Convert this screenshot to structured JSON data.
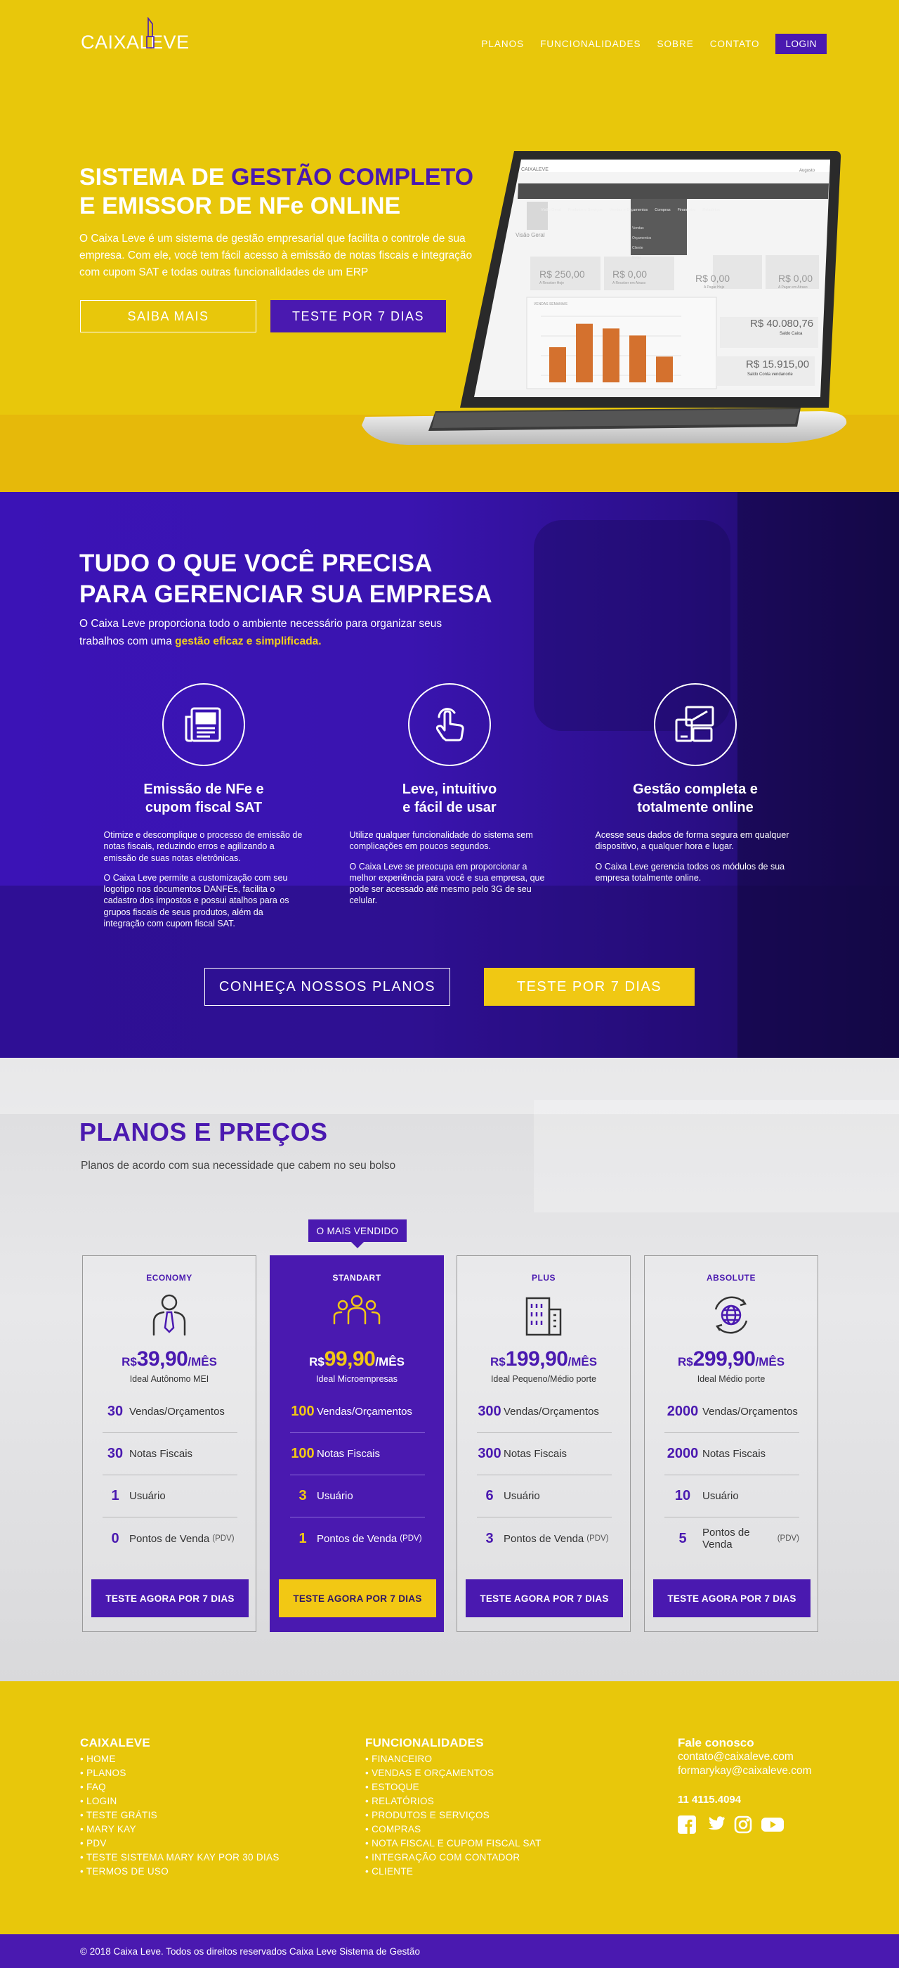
{
  "brand": {
    "logo_text": "CAIXA",
    "logo_text_2": "LEVE",
    "purple": "#4a19b0",
    "yellow": "#e8c70b"
  },
  "nav": {
    "items": [
      "PLANOS",
      "FUNCIONALIDADES",
      "SOBRE",
      "CONTATO"
    ],
    "login": "LOGIN"
  },
  "hero": {
    "title_1a": "SISTEMA DE ",
    "title_1b": "GESTÃO COMPLETO",
    "title_2a": "E EMISSOR DE ",
    "title_2b": "NFe ONLINE",
    "description": "O Caixa Leve é um sistema de gestão empresarial que facilita o controle de sua empresa. Com ele, você tem fácil acesso à emissão de notas fiscais e integração com cupom SAT e todas outras funcionalidades de um ERP",
    "btn_more": "SAIBA MAIS",
    "btn_trial": "TESTE POR 7 DIAS"
  },
  "laptop": {
    "app_logo": "CAIXALEVE",
    "user": "Augusto",
    "menu": [
      "Visão Geral",
      "Produtos e Serviços",
      "Vendas e Orçamentos",
      "Compras",
      "Financeiro",
      "Relatórios"
    ],
    "dropdown": [
      "Vendas",
      "Orçamentos",
      "Cliente",
      "Notas"
    ],
    "page_title": "Visão Geral",
    "kpis": [
      {
        "value": "R$ 250,00",
        "label": "A Receber Hoje"
      },
      {
        "value": "R$ 0,00",
        "label": "A Receber em Atraso"
      },
      {
        "value": "R$ 0,00",
        "label": "A Pagar Hoje"
      },
      {
        "value": "R$ 0,00",
        "label": "A Pagar em Atraso"
      }
    ],
    "chart_title": "VENDAS SEMANAIS",
    "chart_data": {
      "type": "bar",
      "categories": [
        "",
        "",
        "",
        "",
        ""
      ],
      "values": [
        30,
        50,
        46,
        40,
        22
      ],
      "ylim": [
        0,
        60
      ]
    },
    "balances": [
      {
        "value": "R$ 40.080,76",
        "label": "Saldo Caixa"
      },
      {
        "value": "R$ 15.915,00",
        "label": "Saldo Conta vendanorte"
      }
    ]
  },
  "features": {
    "title_1": "TUDO O QUE VOCÊ PRECISA",
    "title_2": "PARA GERENCIAR SUA EMPRESA",
    "desc": "O Caixa Leve proporciona todo o ambiente necessário para organizar seus trabalhos com uma ",
    "desc_hl": "gestão eficaz e simplificada.",
    "items": [
      {
        "icon": "newspaper-icon",
        "name_1": "Emissão de NFe e",
        "name_2": "cupom fiscal SAT",
        "p1": "Otimize e descomplique o processo de emissão de notas fiscais, reduzindo erros e agilizando a emissão de suas notas eletrônicas.",
        "p2": "O Caixa Leve permite a customização com seu logotipo nos documentos DANFEs, facilita o cadastro dos impostos e possui atalhos para os grupos fiscais de seus produtos, além da integração com cupom fiscal SAT."
      },
      {
        "icon": "touch-hand-icon",
        "name_1": "Leve, intuitivo",
        "name_2": "e fácil de usar",
        "p1": "Utilize qualquer funcionalidade do sistema sem complicações em poucos segundos.",
        "p2": "O Caixa Leve se preocupa em proporcionar a melhor experiência para você e sua empresa, que pode ser acessado até mesmo pelo 3G de seu celular."
      },
      {
        "icon": "devices-icon",
        "name_1": "Gestão completa e",
        "name_2": "totalmente online",
        "p1": "Acesse seus dados de forma segura em qualquer dispositivo, a qualquer hora e lugar.",
        "p2": "O Caixa Leve gerencia todos os módulos de sua empresa totalmente online."
      }
    ],
    "btn_plans": "CONHEÇA NOSSOS PLANOS",
    "btn_trial": "TESTE POR 7 DIAS"
  },
  "plans": {
    "title": "PLANOS E PREÇOS",
    "subtitle": "Planos de acordo com sua necessidade que cabem no seu bolso",
    "badge": "O MAIS VENDIDO",
    "currency": "R$",
    "per": "/MÊS",
    "labels": {
      "sales": "Vendas/Orçamentos",
      "invoices": "Notas Fiscais",
      "users": "Usuário",
      "pos": "Pontos de Venda",
      "pos_small": "(PDV)"
    },
    "cards": [
      {
        "name": "ECONOMY",
        "icon": "person-tie-icon",
        "price": "39,90",
        "ideal": "Ideal Autônomo MEI",
        "sales": "30",
        "invoices": "30",
        "users": "1",
        "pos": "0",
        "btn": "TESTE AGORA POR 7 DIAS"
      },
      {
        "name": "STANDART",
        "icon": "team-icon",
        "price": "99,90",
        "ideal": "Ideal Microempresas",
        "sales": "100",
        "invoices": "100",
        "users": "3",
        "pos": "1",
        "btn": "TESTE AGORA POR 7 DIAS"
      },
      {
        "name": "PLUS",
        "icon": "building-icon",
        "price": "199,90",
        "ideal": "Ideal Pequeno/Médio porte",
        "sales": "300",
        "invoices": "300",
        "users": "6",
        "pos": "3",
        "btn": "TESTE AGORA POR 7 DIAS"
      },
      {
        "name": "ABSOLUTE",
        "icon": "globe-icon",
        "price": "299,90",
        "ideal": "Ideal Médio porte",
        "sales": "2000",
        "invoices": "2000",
        "users": "10",
        "pos": "5",
        "btn": "TESTE AGORA POR 7 DIAS"
      }
    ]
  },
  "footer": {
    "col1_title": "CAIXALEVE",
    "col1": [
      "• HOME",
      "• PLANOS",
      "• FAQ",
      "• LOGIN",
      "• TESTE GRÁTIS",
      "• MARY KAY",
      "• PDV",
      "• TESTE SISTEMA MARY KAY POR 30 DIAS",
      "• TERMOS DE USO"
    ],
    "col2_title": "FUNCIONALIDADES",
    "col2": [
      "• FINANCEIRO",
      "• VENDAS E ORÇAMENTOS",
      "• ESTOQUE",
      "• RELATÓRIOS",
      "• PRODUTOS E SERVIÇOS",
      "• COMPRAS",
      "• NOTA FISCAL E CUPOM FISCAL SAT",
      "• INTEGRAÇÃO COM CONTADOR",
      "• CLIENTE"
    ],
    "contact_title": "Fale conosco",
    "email_1": "contato@caixaleve.com",
    "email_2": "formarykay@caixaleve.com",
    "phone": "11 4115.4094",
    "socials": [
      "facebook-icon",
      "twitter-icon",
      "instagram-icon",
      "youtube-icon"
    ],
    "copyright": "© 2018 Caixa Leve. Todos os direitos reservados Caixa Leve Sistema de Gestão"
  }
}
